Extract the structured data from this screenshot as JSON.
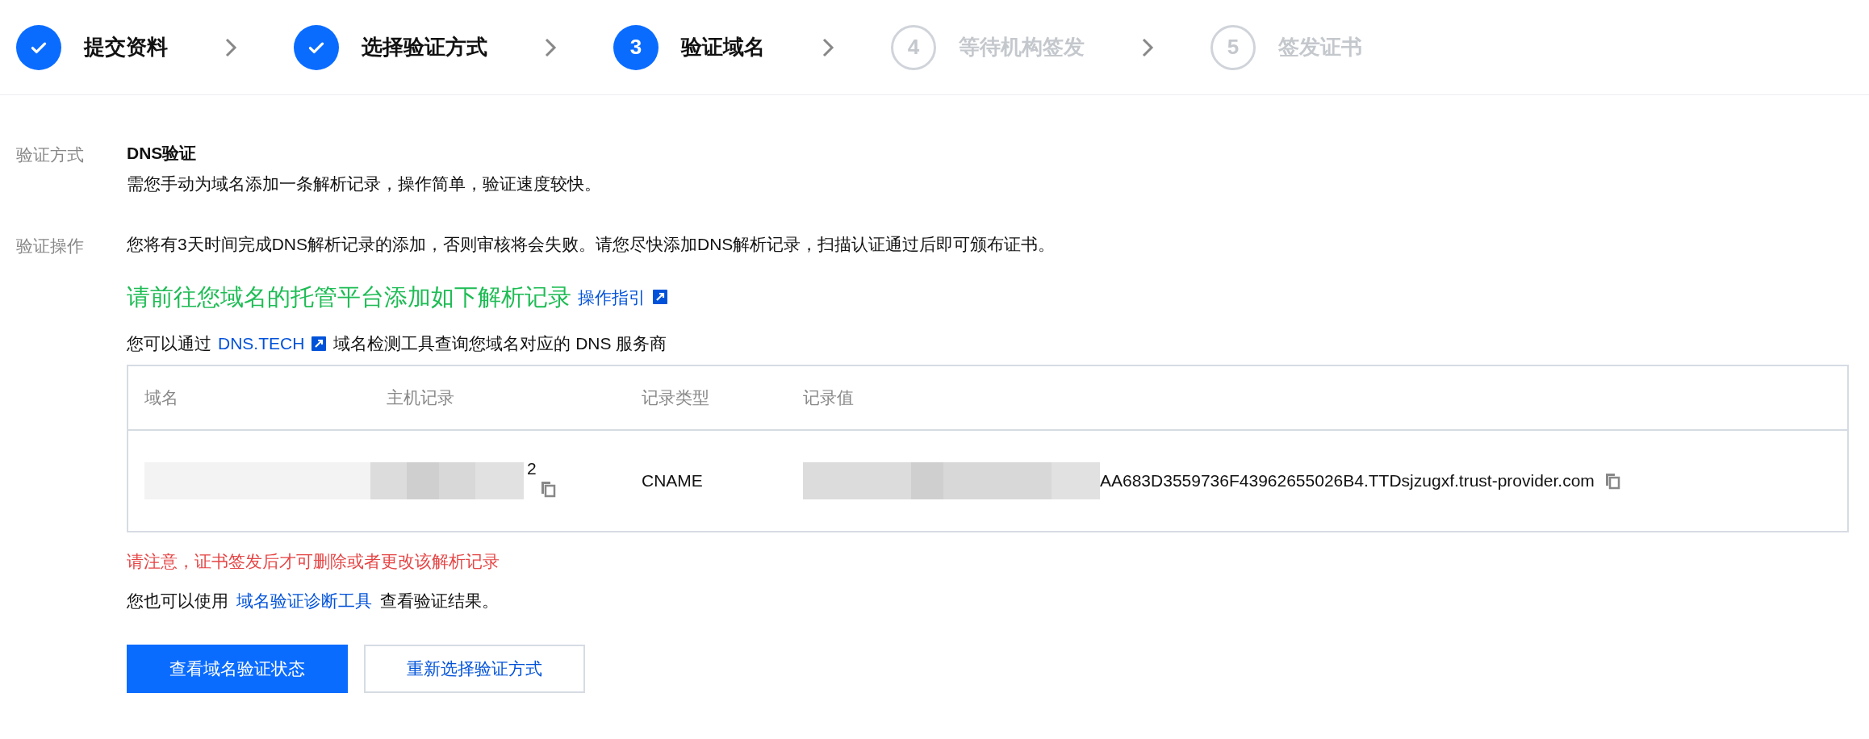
{
  "steps": [
    {
      "kind": "done",
      "label": "提交资料"
    },
    {
      "kind": "done",
      "label": "选择验证方式"
    },
    {
      "kind": "current",
      "number": "3",
      "label": "验证域名"
    },
    {
      "kind": "pending",
      "number": "4",
      "label": "等待机构签发"
    },
    {
      "kind": "pending",
      "number": "5",
      "label": "签发证书"
    }
  ],
  "method": {
    "label": "验证方式",
    "title": "DNS验证",
    "description": "需您手动为域名添加一条解析记录，操作简单，验证速度较快。"
  },
  "operation": {
    "label": "验证操作",
    "notice": "您将有3天时间完成DNS解析记录的添加，否则审核将会失败。请您尽快添加DNS解析记录，扫描认证通过后即可颁布证书。",
    "heading": "请前往您域名的托管平台添加如下解析记录",
    "guide_link": "操作指引",
    "lookup_prefix": "您可以通过",
    "lookup_link": "DNS.TECH",
    "lookup_suffix": "域名检测工具查询您域名对应的 DNS 服务商"
  },
  "table": {
    "columns": [
      "域名",
      "主机记录",
      "记录类型",
      "记录值"
    ],
    "rows": [
      {
        "domain": {
          "kind": "redacted"
        },
        "host": {
          "kind": "redacted",
          "visible": "2"
        },
        "type": "CNAME",
        "value": {
          "kind": "redacted",
          "visible": "AA683D3559736F43962655026B4.TTDsjzugxf.trust-provider.com"
        }
      }
    ]
  },
  "warning": "请注意，证书签发后才可删除或者更改该解析记录",
  "diagnose": {
    "prefix": "您也可以使用",
    "link": "域名验证诊断工具",
    "suffix": "查看验证结果。"
  },
  "buttons": [
    {
      "label": "查看域名验证状态",
      "kind": "primary"
    },
    {
      "label": "重新选择验证方式",
      "kind": "secondary"
    }
  ]
}
